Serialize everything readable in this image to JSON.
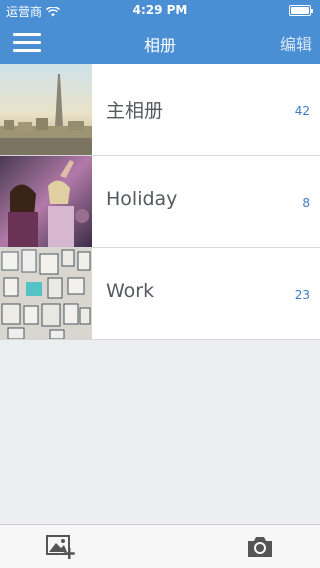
{
  "status_bar": {
    "carrier": "运营商",
    "time": "4:29 PM"
  },
  "nav": {
    "title": "相册",
    "edit_label": "编辑"
  },
  "albums": [
    {
      "name": "主相册",
      "count": "42",
      "thumb": "city-skyline-photo"
    },
    {
      "name": "Holiday",
      "count": "8",
      "thumb": "party-photo"
    },
    {
      "name": "Work",
      "count": "23",
      "thumb": "pinboard-photo"
    }
  ],
  "toolbar": {
    "left_icon": "add-photo-icon",
    "right_icon": "camera-icon"
  },
  "colors": {
    "header": "#4a8fd4",
    "count_text": "#3a7cc4",
    "background": "#eceff2"
  }
}
